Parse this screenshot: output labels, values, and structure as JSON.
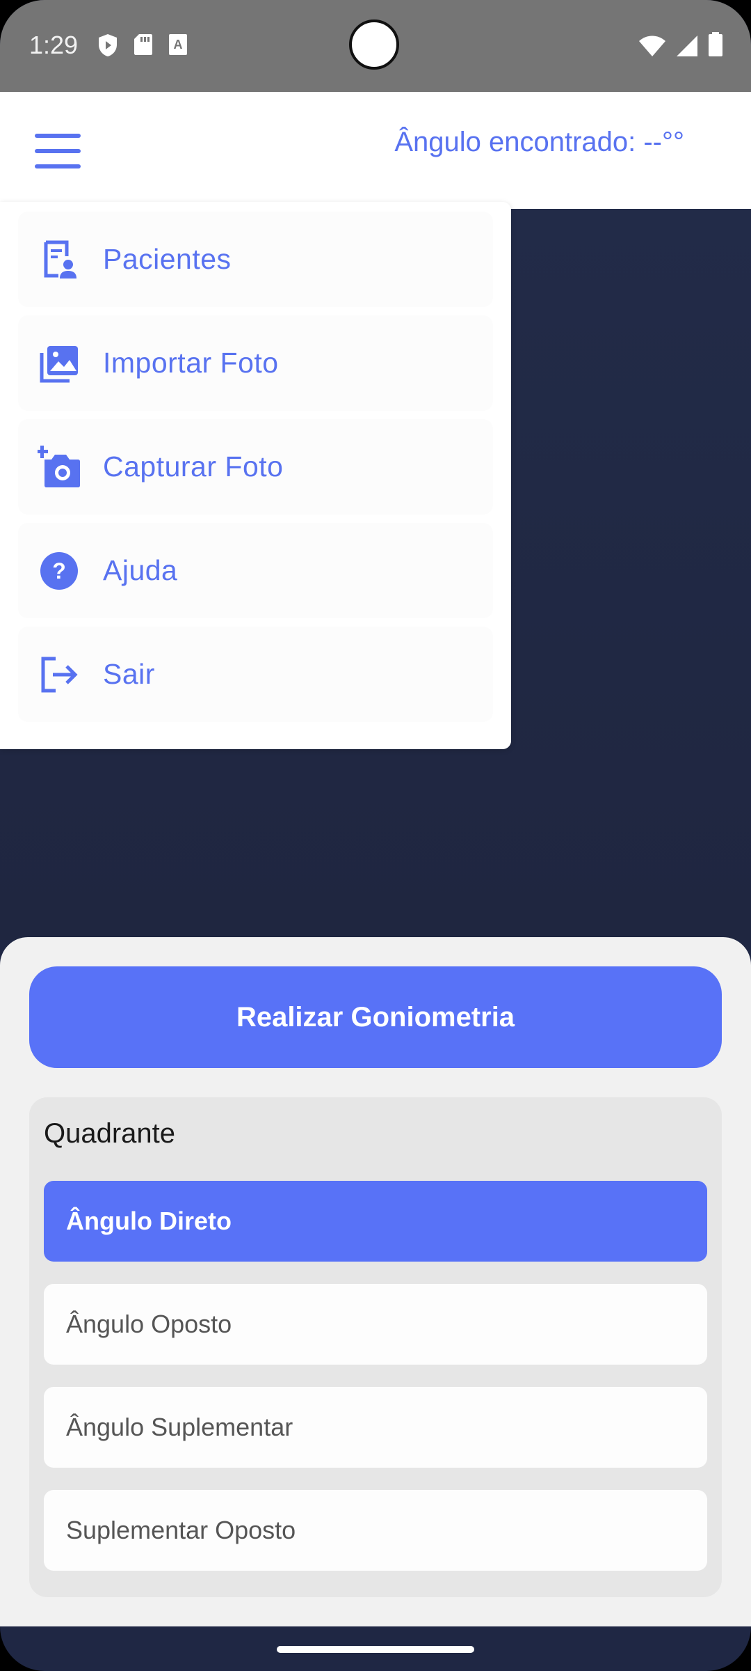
{
  "status_bar": {
    "time": "1:29",
    "left_icons": [
      "shield-play-icon",
      "sd-card-icon",
      "text-a-icon"
    ],
    "right_icons": [
      "wifi-icon",
      "signal-icon",
      "battery-icon"
    ]
  },
  "app_bar": {
    "menu_icon": "hamburger-menu-icon",
    "angle_text": "Ângulo encontrado: --°°"
  },
  "drawer": {
    "items": [
      {
        "label": "Pacientes",
        "icon": "patients-list-icon"
      },
      {
        "label": "Importar Foto",
        "icon": "photo-library-icon"
      },
      {
        "label": "Capturar Foto",
        "icon": "add-camera-icon"
      },
      {
        "label": "Ajuda",
        "icon": "help-icon"
      },
      {
        "label": "Sair",
        "icon": "logout-icon"
      }
    ]
  },
  "actions": {
    "goniometry_button": "Realizar Goniometria"
  },
  "quadrant": {
    "title": "Quadrante",
    "options": [
      {
        "label": "Ângulo Direto",
        "selected": true
      },
      {
        "label": "Ângulo Oposto",
        "selected": false
      },
      {
        "label": "Ângulo Suplementar",
        "selected": false
      },
      {
        "label": "Suplementar Oposto",
        "selected": false
      }
    ]
  },
  "colors": {
    "accent": "#5872f7",
    "status_bar": "#757575",
    "canvas": "#1f2744"
  }
}
